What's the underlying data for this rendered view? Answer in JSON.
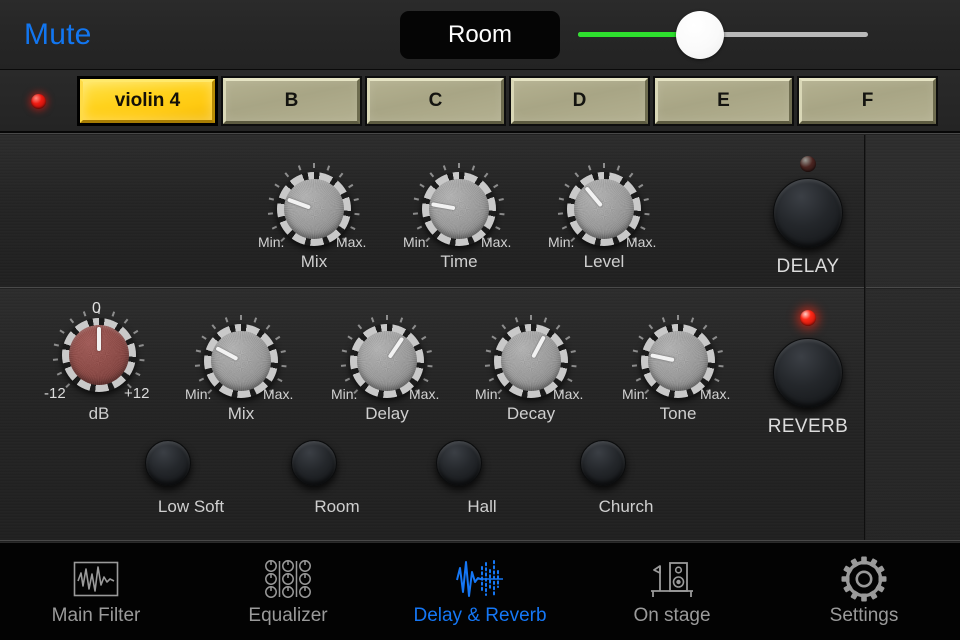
{
  "topbar": {
    "mute_label": "Mute",
    "room_button_label": "Room",
    "slider": {
      "name": "volume-slider",
      "value_percent": 42,
      "fill_color": "#2ee02e",
      "track_color": "#b9b9b9",
      "thumb_color": "#ffffff"
    }
  },
  "presets": {
    "led_color": "#f01b12",
    "items": [
      {
        "label": "violin 4",
        "active": true
      },
      {
        "label": "B",
        "active": false
      },
      {
        "label": "C",
        "active": false
      },
      {
        "label": "D",
        "active": false
      },
      {
        "label": "E",
        "active": false
      },
      {
        "label": "F",
        "active": false
      }
    ]
  },
  "delay_section": {
    "title": "DELAY",
    "power_led_on": false,
    "min_label": "Min.",
    "max_label": "Max.",
    "knobs": [
      {
        "label": "Mix",
        "angle_deg": -70,
        "min": "Min.",
        "max": "Max."
      },
      {
        "label": "Time",
        "angle_deg": -80,
        "min": "Min.",
        "max": "Max."
      },
      {
        "label": "Level",
        "angle_deg": -40,
        "min": "Min.",
        "max": "Max."
      }
    ]
  },
  "reverb_section": {
    "title": "REVERB",
    "power_led_on": true,
    "gain_knob": {
      "label": "dB",
      "angle_deg": 0,
      "center_tick": "0",
      "min": "-12",
      "max": "+12",
      "color": "#8e4b47"
    },
    "knobs": [
      {
        "label": "Mix",
        "angle_deg": -62,
        "min": "Min.",
        "max": "Max."
      },
      {
        "label": "Delay",
        "angle_deg": 34,
        "min": "Min.",
        "max": "Max."
      },
      {
        "label": "Decay",
        "angle_deg": 28,
        "min": "Min.",
        "max": "Max."
      },
      {
        "label": "Tone",
        "angle_deg": -78,
        "min": "Min.",
        "max": "Max."
      }
    ],
    "presets": [
      {
        "label": "Low Soft"
      },
      {
        "label": "Room"
      },
      {
        "label": "Hall"
      },
      {
        "label": "Church"
      }
    ]
  },
  "tabbar": {
    "active_color": "#1577f5",
    "inactive_color": "#9a9a9a",
    "tabs": [
      {
        "label": "Main Filter",
        "icon": "waveform-box-icon",
        "active": false
      },
      {
        "label": "Equalizer",
        "icon": "knob-grid-icon",
        "active": false
      },
      {
        "label": "Delay & Reverb",
        "icon": "delay-reverb-icon",
        "active": true
      },
      {
        "label": "On stage",
        "icon": "stage-speaker-icon",
        "active": false
      },
      {
        "label": "Settings",
        "icon": "gear-icon",
        "active": false
      }
    ]
  }
}
